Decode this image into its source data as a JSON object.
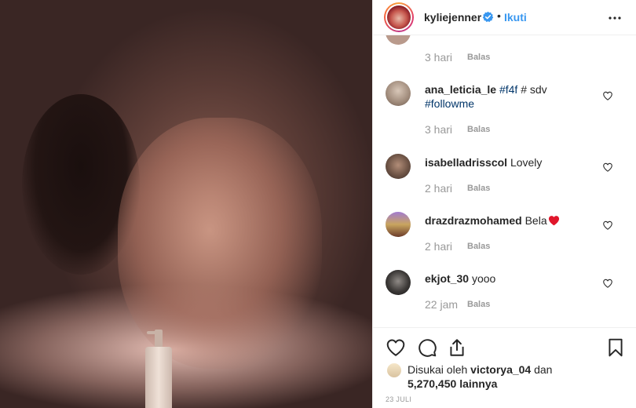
{
  "post": {
    "username": "kyliejenner",
    "separator": "•",
    "follow_label": "Ikuti",
    "image_description_icon": "post-photo"
  },
  "comments": {
    "partial": {
      "time": "3 hari",
      "reply": "Balas"
    },
    "items": [
      {
        "user": "ana_leticia_le",
        "text_parts": [
          "#f4f",
          " # sdv ",
          "#followme"
        ],
        "time": "3 hari",
        "reply": "Balas"
      },
      {
        "user": "isabelladrisscol",
        "text": "Lovely",
        "time": "2 hari",
        "reply": "Balas"
      },
      {
        "user": "drazdrazmohamed",
        "text": "Bela",
        "emoji": "heart-emoji",
        "time": "2 hari",
        "reply": "Balas"
      },
      {
        "user": "ekjot_30",
        "text": "yooo",
        "time": "22 jam",
        "reply": "Balas"
      }
    ]
  },
  "likes": {
    "prefix": "Disukai oleh",
    "user": "victorya_04",
    "and": "dan",
    "count": "5,270,450",
    "suffix": "lainnya"
  },
  "date": "23 JULI",
  "colors": {
    "accent": "#3897f0",
    "hashtag": "#003569",
    "muted": "#999999",
    "heart": "#ed4956"
  }
}
